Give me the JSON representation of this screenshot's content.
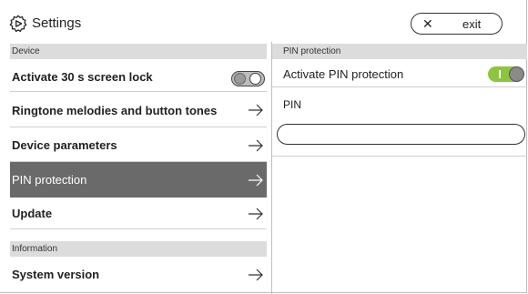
{
  "header": {
    "title": "Settings",
    "icon": "settings-gear-icon",
    "exit_label": "exit",
    "exit_icon": "close-icon"
  },
  "left": {
    "sections": [
      {
        "title": "Device"
      },
      {
        "title": "Information"
      }
    ],
    "items": [
      {
        "label": "Activate 30 s screen lock",
        "control": "toggle",
        "toggle_on": false
      },
      {
        "label": "Ringtone melodies and button tones",
        "control": "arrow"
      },
      {
        "label": "Device parameters",
        "control": "arrow"
      },
      {
        "label": "PIN protection",
        "control": "arrow",
        "active": true
      },
      {
        "label": "Update",
        "control": "arrow"
      },
      {
        "label": "System version",
        "control": "arrow"
      }
    ]
  },
  "right": {
    "section_title": "PIN protection",
    "activate_label": "Activate PIN protection",
    "activate_on": true,
    "pin_label": "PIN",
    "pin_value": ""
  },
  "colors": {
    "accent_toggle_on": "#8cc63f",
    "active_row_bg": "#6a6a6a",
    "section_bg": "#dcdcdc"
  }
}
